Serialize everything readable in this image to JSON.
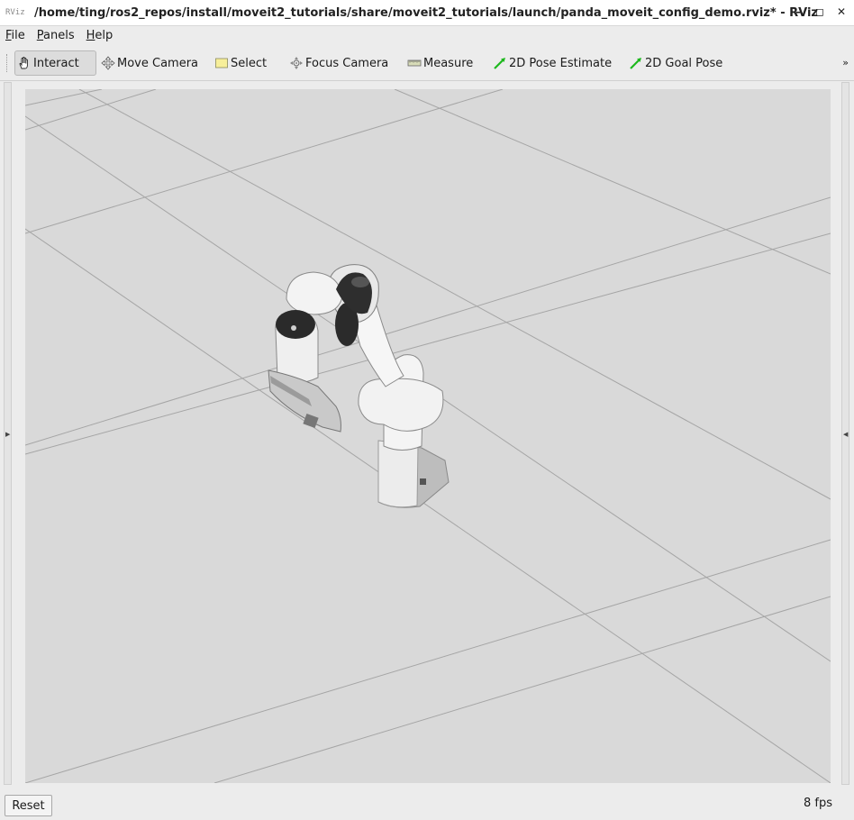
{
  "window": {
    "title": "/home/ting/ros2_repos/install/moveit2_tutorials/share/moveit2_tutorials/launch/panda_moveit_config_demo.rviz* - RViz",
    "logo_text": "RViz",
    "controls": [
      "minimize",
      "maximize",
      "close"
    ]
  },
  "menubar": {
    "items": [
      {
        "label": "File",
        "mnemonic": "F",
        "rest": "ile"
      },
      {
        "label": "Panels",
        "mnemonic": "P",
        "rest": "anels"
      },
      {
        "label": "Help",
        "mnemonic": "H",
        "rest": "elp"
      }
    ]
  },
  "toolbar": {
    "tools": [
      {
        "label": "Interact",
        "icon": "hand-icon",
        "active": true
      },
      {
        "label": "Move Camera",
        "icon": "move-camera-icon",
        "active": false
      },
      {
        "label": "Select",
        "icon": "select-icon",
        "active": false
      },
      {
        "label": "Focus Camera",
        "icon": "focus-camera-icon",
        "active": false
      },
      {
        "label": "Measure",
        "icon": "ruler-icon",
        "active": false
      },
      {
        "label": "2D Pose Estimate",
        "icon": "green-arrow-icon",
        "active": false
      },
      {
        "label": "2D Goal Pose",
        "icon": "green-arrow-icon",
        "active": false
      }
    ],
    "overflow": "»"
  },
  "viewport": {
    "background_color": "#d8d8d8",
    "grid_color": "#a2a2a2",
    "scene": "Panda robot arm on grid"
  },
  "status": {
    "reset_label": "Reset",
    "fps": "8 fps"
  }
}
